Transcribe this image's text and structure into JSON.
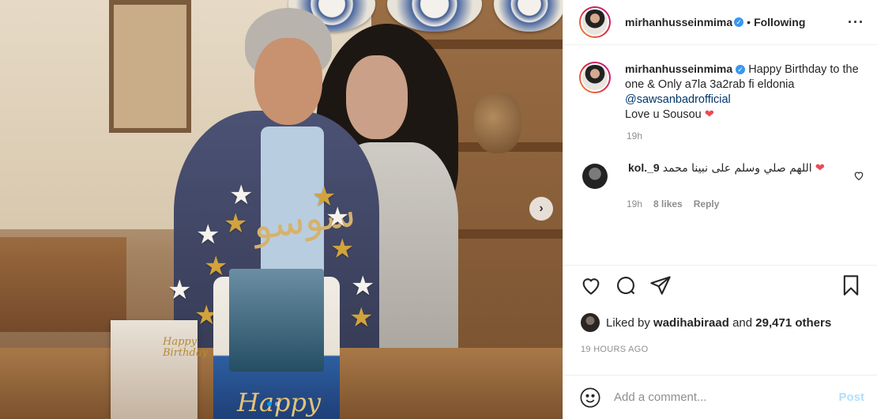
{
  "post": {
    "username": "mirhanhusseinmima",
    "verified": true,
    "follow_state": "Following",
    "more_icon": "more-horizontal-icon"
  },
  "caption": {
    "username": "mirhanhusseinmima",
    "text_before": "Happy Birthday to the one & Only a7la 3a2rab fi eldonia",
    "mention": "@sawsanbadrofficial",
    "text_after": "Love u Sousou",
    "emoji": "❤",
    "time": "19h"
  },
  "comments": [
    {
      "username": "kol._9",
      "text": "اللهم صلي وسلم على نبينا محمد",
      "emoji": "❤",
      "time": "19h",
      "likes": "8 likes",
      "reply": "Reply"
    }
  ],
  "photo": {
    "cake_text": "Happy",
    "card_text": "Happy Birthday",
    "carousel_total": 2,
    "carousel_active": 0,
    "next_icon": "chevron-right-icon"
  },
  "actions": {
    "like_icon": "heart-icon",
    "comment_icon": "comment-icon",
    "share_icon": "share-icon",
    "save_icon": "bookmark-icon"
  },
  "likes": {
    "prefix": "Liked by",
    "user": "wadihabiraad",
    "middle": "and",
    "count": "29,471 others"
  },
  "posted_ago": "19 HOURS AGO",
  "add_comment": {
    "placeholder": "Add a comment...",
    "post_label": "Post"
  },
  "colors": {
    "verified": "#3897f0",
    "link": "#00376b",
    "heart": "#ed4956",
    "post_disabled": "#b2dffc",
    "muted": "#8e8e8e"
  }
}
